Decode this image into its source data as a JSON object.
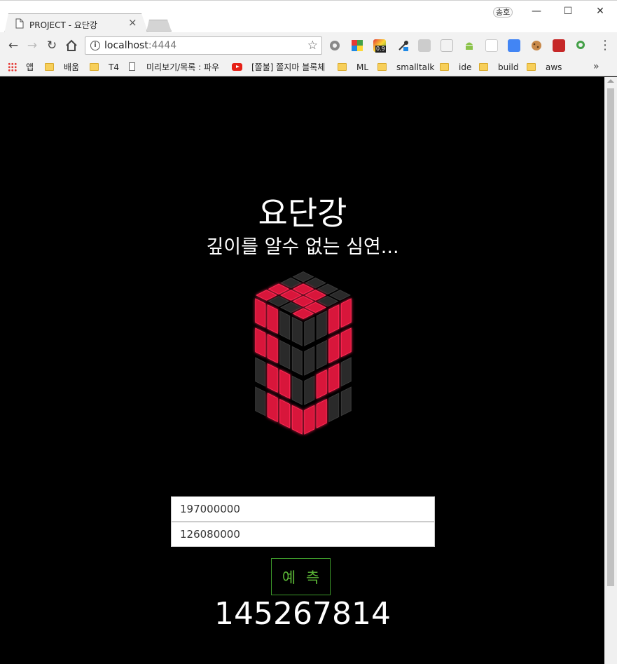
{
  "browser": {
    "tab_title": "PROJECT - 요단강",
    "tab_close": "×",
    "profile": "송호",
    "window": {
      "minimize": "—",
      "maximize": "☐",
      "close": "✕"
    },
    "url_host": "localhost",
    "url_port": ":4444",
    "ext_badge": "0.9",
    "bookmarks": [
      {
        "label": "앱",
        "icon": "apps-grid-icon"
      },
      {
        "label": "배움",
        "icon": "folder-icon"
      },
      {
        "label": "T4",
        "icon": "folder-icon"
      },
      {
        "label": "미리보기/목록 : 파우",
        "icon": "page-icon"
      },
      {
        "label": "[쫄불] 쫄지마 블록체",
        "icon": "youtube-icon"
      },
      {
        "label": "ML",
        "icon": "folder-icon"
      },
      {
        "label": "smalltalk",
        "icon": "folder-icon"
      },
      {
        "label": "ide",
        "icon": "folder-icon"
      },
      {
        "label": "build",
        "icon": "folder-icon"
      },
      {
        "label": "aws",
        "icon": "folder-icon"
      }
    ],
    "bookmarks_more": "»"
  },
  "page": {
    "title": "요단강",
    "subtitle": "깊이를 알수 없는 심연...",
    "input1_value": "197000000",
    "input2_value": "126080000",
    "predict_label": "예 측",
    "result": "145267814"
  },
  "colors": {
    "accent_red": "#d8143a",
    "tile_dark": "#2a2a2a",
    "button_green": "#5ab536"
  }
}
